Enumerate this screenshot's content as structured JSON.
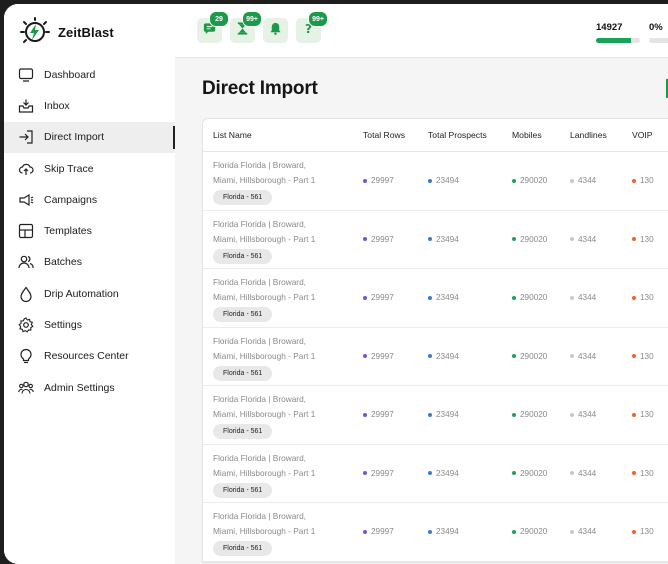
{
  "app": {
    "name": "ZeitBlast"
  },
  "colors": {
    "accent": "#1a9a4a",
    "rows_dot": "#6b5bd6",
    "prospects_dot": "#3a7bd5",
    "mobiles_dot": "#22a05a",
    "landlines_dot": "#c9c9c9",
    "voip_dot": "#f0632a"
  },
  "sidebar": {
    "items": [
      {
        "label": "Dashboard",
        "icon": "monitor-icon"
      },
      {
        "label": "Inbox",
        "icon": "inbox-icon"
      },
      {
        "label": "Direct Import",
        "icon": "import-icon"
      },
      {
        "label": "Skip Trace",
        "icon": "cloud-upload-icon"
      },
      {
        "label": "Campaigns",
        "icon": "megaphone-icon"
      },
      {
        "label": "Templates",
        "icon": "templates-icon"
      },
      {
        "label": "Batches",
        "icon": "people-icon"
      },
      {
        "label": "Drip Automation",
        "icon": "drop-icon"
      },
      {
        "label": "Settings",
        "icon": "gear-icon"
      },
      {
        "label": "Resources Center",
        "icon": "lightbulb-icon"
      },
      {
        "label": "Admin Settings",
        "icon": "group-icon"
      }
    ]
  },
  "topbar": {
    "buttons": [
      {
        "icon": "chat-icon",
        "badge": "29"
      },
      {
        "icon": "hourglass-icon",
        "badge": "99+"
      },
      {
        "icon": "bell-icon",
        "badge": ""
      },
      {
        "icon": "question-icon",
        "badge": "99+"
      }
    ],
    "credits": "14927",
    "credits_fill": 0.8,
    "percent": "0%"
  },
  "main": {
    "title": "Direct Import",
    "columns": [
      "List Name",
      "Total Rows",
      "Total Prospects",
      "Mobiles",
      "Landlines",
      "VOIP"
    ],
    "rows": [
      {
        "name_line1": "Florida Florida | Broward,",
        "name_line2": "Miami, Hillsborough - Part 1",
        "tag": "Florida - 561",
        "total_rows": "29997",
        "total_prospects": "23494",
        "mobiles": "290020",
        "landlines": "4344",
        "voip": "130"
      },
      {
        "name_line1": "Florida Florida | Broward,",
        "name_line2": "Miami, Hillsborough - Part 1",
        "tag": "Florida - 561",
        "total_rows": "29997",
        "total_prospects": "23494",
        "mobiles": "290020",
        "landlines": "4344",
        "voip": "130"
      },
      {
        "name_line1": "Florida Florida | Broward,",
        "name_line2": "Miami, Hillsborough - Part 1",
        "tag": "Florida - 561",
        "total_rows": "29997",
        "total_prospects": "23494",
        "mobiles": "290020",
        "landlines": "4344",
        "voip": "130"
      },
      {
        "name_line1": "Florida Florida | Broward,",
        "name_line2": "Miami, Hillsborough - Part 1",
        "tag": "Florida - 561",
        "total_rows": "29997",
        "total_prospects": "23494",
        "mobiles": "290020",
        "landlines": "4344",
        "voip": "130"
      },
      {
        "name_line1": "Florida Florida | Broward,",
        "name_line2": "Miami, Hillsborough - Part 1",
        "tag": "Florida - 561",
        "total_rows": "29997",
        "total_prospects": "23494",
        "mobiles": "290020",
        "landlines": "4344",
        "voip": "130"
      },
      {
        "name_line1": "Florida Florida | Broward,",
        "name_line2": "Miami, Hillsborough - Part 1",
        "tag": "Florida - 561",
        "total_rows": "29997",
        "total_prospects": "23494",
        "mobiles": "290020",
        "landlines": "4344",
        "voip": "130"
      },
      {
        "name_line1": "Florida Florida | Broward,",
        "name_line2": "Miami, Hillsborough - Part 1",
        "tag": "Florida - 561",
        "total_rows": "29997",
        "total_prospects": "23494",
        "mobiles": "290020",
        "landlines": "4344",
        "voip": "130"
      }
    ]
  }
}
